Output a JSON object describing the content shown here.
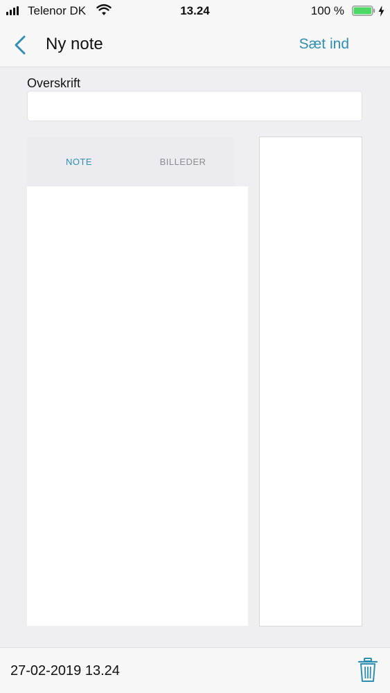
{
  "status_bar": {
    "carrier": "Telenor DK",
    "time": "13.24",
    "battery": "100 %",
    "battery_color": "#4cd964"
  },
  "nav": {
    "back_icon": "chevron-left-icon",
    "title": "Ny note",
    "paste_label": "Sæt ind",
    "accent_color": "#2f8fb3"
  },
  "form": {
    "heading_label": "Overskrift",
    "heading_value": ""
  },
  "tabs": [
    {
      "label": "NOTE",
      "active": true
    },
    {
      "label": "BILLEDER",
      "active": false
    }
  ],
  "footer": {
    "timestamp": "27-02-2019 13.24",
    "delete_icon": "trash-icon"
  }
}
